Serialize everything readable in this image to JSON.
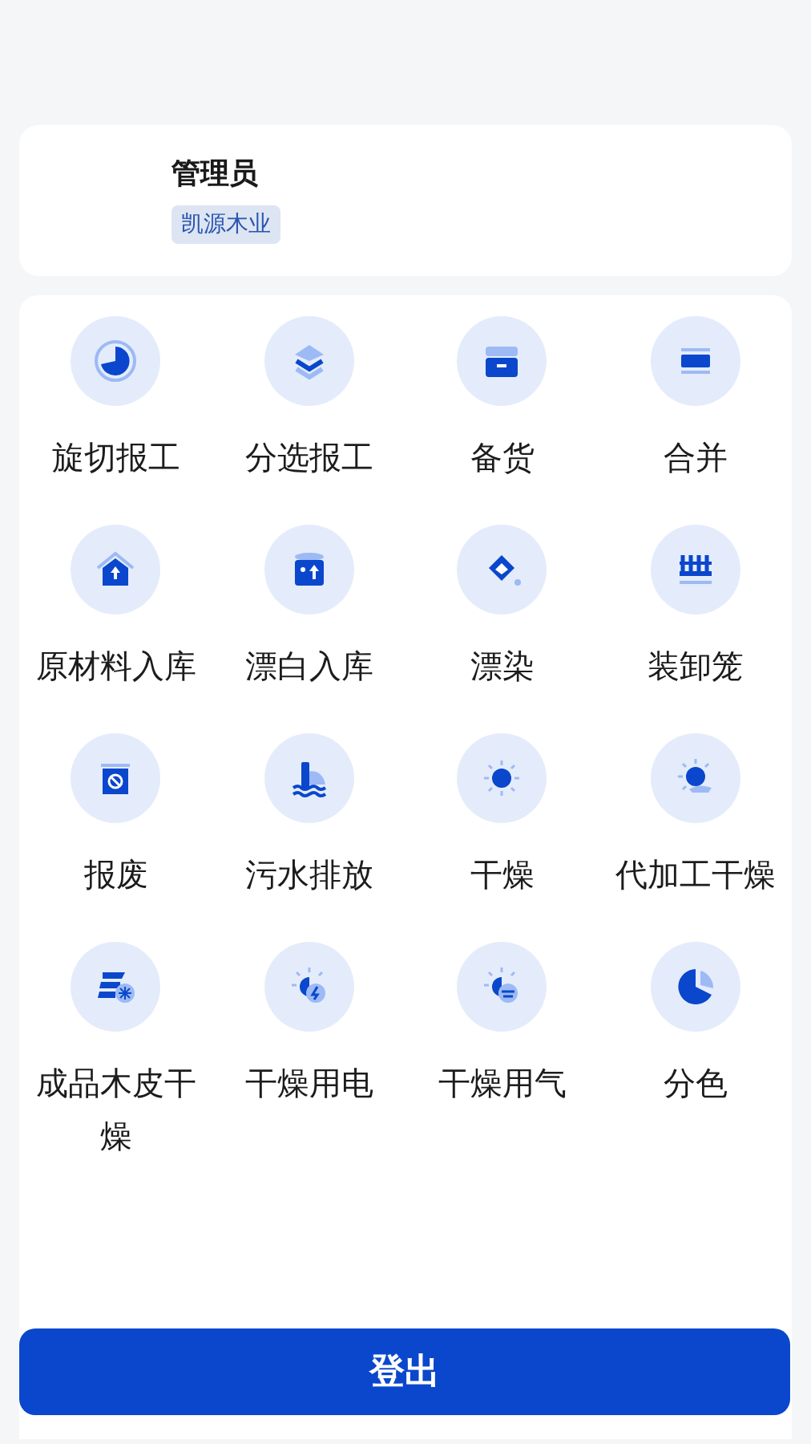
{
  "profile": {
    "name": "管理员",
    "company": "凯源木业"
  },
  "menu": [
    {
      "label": "旋切报工"
    },
    {
      "label": "分选报工"
    },
    {
      "label": "备货"
    },
    {
      "label": "合并"
    },
    {
      "label": "原材料入库"
    },
    {
      "label": "漂白入库"
    },
    {
      "label": "漂染"
    },
    {
      "label": "装卸笼"
    },
    {
      "label": "报废"
    },
    {
      "label": "污水排放"
    },
    {
      "label": "干燥"
    },
    {
      "label": "代加工干燥"
    },
    {
      "label": "成品木皮干燥"
    },
    {
      "label": "干燥用电"
    },
    {
      "label": "干燥用气"
    },
    {
      "label": "分色"
    }
  ],
  "logout_button": "登出"
}
